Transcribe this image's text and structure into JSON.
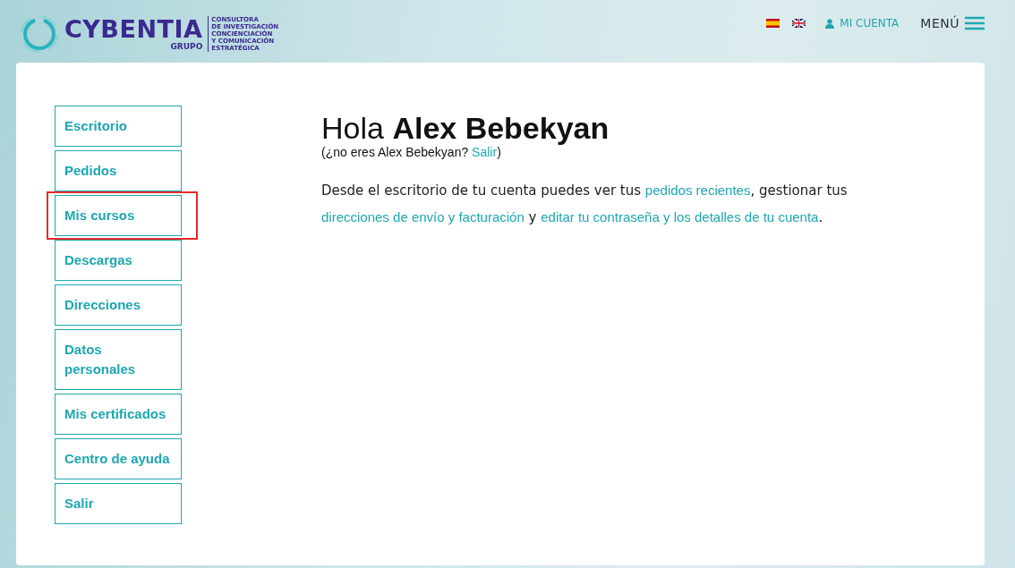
{
  "header": {
    "logo": {
      "name": "CYBENTIA",
      "sub": "GRUPO",
      "tagline": [
        "CONSULTORA",
        "DE INVESTIGACIÓN",
        "CONCIENCIACIÓN",
        "Y COMUNICACIÓN",
        "ESTRATÉGICA"
      ]
    },
    "account_link": "MI CUENTA",
    "menu_label": "MENÚ"
  },
  "sidebar": {
    "items": [
      {
        "label": "Escritorio",
        "highlighted": false
      },
      {
        "label": "Pedidos",
        "highlighted": false
      },
      {
        "label": "Mis cursos",
        "highlighted": true
      },
      {
        "label": "Descargas",
        "highlighted": false
      },
      {
        "label": "Direcciones",
        "highlighted": false
      },
      {
        "label": "Datos personales",
        "highlighted": false
      },
      {
        "label": "Mis certificados",
        "highlighted": false
      },
      {
        "label": "Centro de ayuda",
        "highlighted": false
      },
      {
        "label": "Salir",
        "highlighted": false
      }
    ]
  },
  "greeting": {
    "prefix": "Hola",
    "name": "Alex Bebekyan",
    "note_before": "(¿no eres Alex Bebekyan? ",
    "note_link": "Salir",
    "note_after": ")"
  },
  "intro": [
    {
      "kind": "text",
      "text": "Desde el escritorio de tu cuenta puedes ver tus "
    },
    {
      "kind": "link",
      "text": "pedidos recientes"
    },
    {
      "kind": "text",
      "text": ", gestionar tus "
    },
    {
      "kind": "link",
      "text": "direcciones de envío y facturación"
    },
    {
      "kind": "text",
      "text": " y "
    },
    {
      "kind": "link",
      "text": "editar tu contraseña y los detalles de tu cuenta"
    },
    {
      "kind": "text",
      "text": "."
    }
  ]
}
